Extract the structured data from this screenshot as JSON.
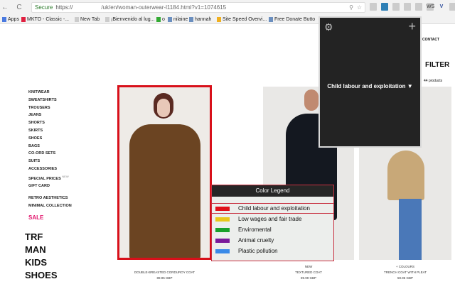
{
  "browser": {
    "secure_label": "Secure",
    "url_prefix": "https://",
    "url": "/uk/en/woman-outerwear-l1184.html?v1=1074615",
    "ext_ws": "WS",
    "ext_v": "V"
  },
  "bookmarks": [
    "Apps",
    "MKTO - Classic -...",
    "New Tab",
    "¡Bienvenido al lug...",
    "o",
    "nilaine",
    "hannah",
    "Site Speed Overvi...",
    "Free Donate Butto"
  ],
  "sidebar": {
    "items": [
      "KNITWEAR",
      "SWEATSHIRTS",
      "TROUSERS",
      "JEANS",
      "SHORTS",
      "SKIRTS",
      "SHOES",
      "BAGS",
      "CO-ORD SETS",
      "SUITS",
      "ACCESSORIES",
      "SPECIAL PRICES",
      "GIFT CARD"
    ],
    "special_badge": "NEW",
    "collections": [
      "RETRO AESTHETICS",
      "MINIMAL COLLECTION"
    ],
    "sale": "SALE",
    "sections": [
      "TRF",
      "MAN",
      "KIDS",
      "SHOES"
    ]
  },
  "header": {
    "contact": "CONTACT",
    "filter": "FILTER",
    "count": "44 products"
  },
  "products": [
    {
      "tag": "",
      "name": "DOUBLE-BREASTED CORDUROY COAT",
      "price": "89.95 GBP"
    },
    {
      "tag": "NEW",
      "name": "TEXTURED COAT",
      "price": "89.99 GBP"
    },
    {
      "tag": "+ COLOURS",
      "name": "TRENCH COAT WITH PLEAT",
      "price": "59.95 GBP"
    }
  ],
  "popup": {
    "selected": "Child labour and exploitation ▼",
    "gear": "gear-icon",
    "plus": "plus-icon"
  },
  "legend": {
    "title": "Color Legend",
    "items": [
      {
        "label": "Child labour and exploitation",
        "color": "#e0101a"
      },
      {
        "label": "Low wages and fair trade",
        "color": "#e8c81a"
      },
      {
        "label": "Enviromental",
        "color": "#1aa02a"
      },
      {
        "label": "Animal cruelty",
        "color": "#7a1a9a"
      },
      {
        "label": "Plastic pollution",
        "color": "#3a8ae8"
      }
    ]
  }
}
